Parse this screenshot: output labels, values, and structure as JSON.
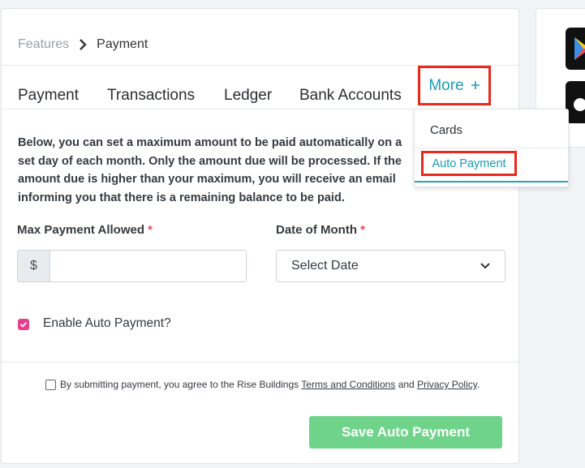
{
  "breadcrumb": {
    "parent": "Features",
    "current": "Payment"
  },
  "tabs": [
    "Payment",
    "Transactions",
    "Ledger",
    "Bank Accounts"
  ],
  "more_tab": {
    "label": "More",
    "icon": "plus-icon"
  },
  "dropdown": {
    "items": [
      "Cards",
      "Auto Payment"
    ]
  },
  "description": "Below, you can set a maximum amount to be paid automatically on a set day of each month. Only the amount due will be processed. If the amount due is higher than your maximum, you will receive an email informing you that there is a remaining balance to be paid.",
  "form": {
    "max_payment": {
      "label": "Max Payment Allowed",
      "required_mark": "*",
      "prefix": "$",
      "value": ""
    },
    "date_of_month": {
      "label": "Date of Month",
      "required_mark": "*",
      "selected": "Select Date"
    },
    "enable_auto_payment": {
      "label": "Enable Auto Payment?",
      "checked": true
    }
  },
  "agreement": {
    "prefix": "By submitting payment, you agree to the Rise Buildings",
    "terms_link": "Terms and Conditions",
    "conjunction": "and",
    "privacy_link": "Privacy Policy",
    "suffix": ".",
    "checked": false
  },
  "save_button": "Save Auto Payment",
  "colors": {
    "accent": "#1a9bb5",
    "highlight_border": "#e82a1c",
    "checkbox": "#e83e8c",
    "save_button": "#6fd48a"
  }
}
